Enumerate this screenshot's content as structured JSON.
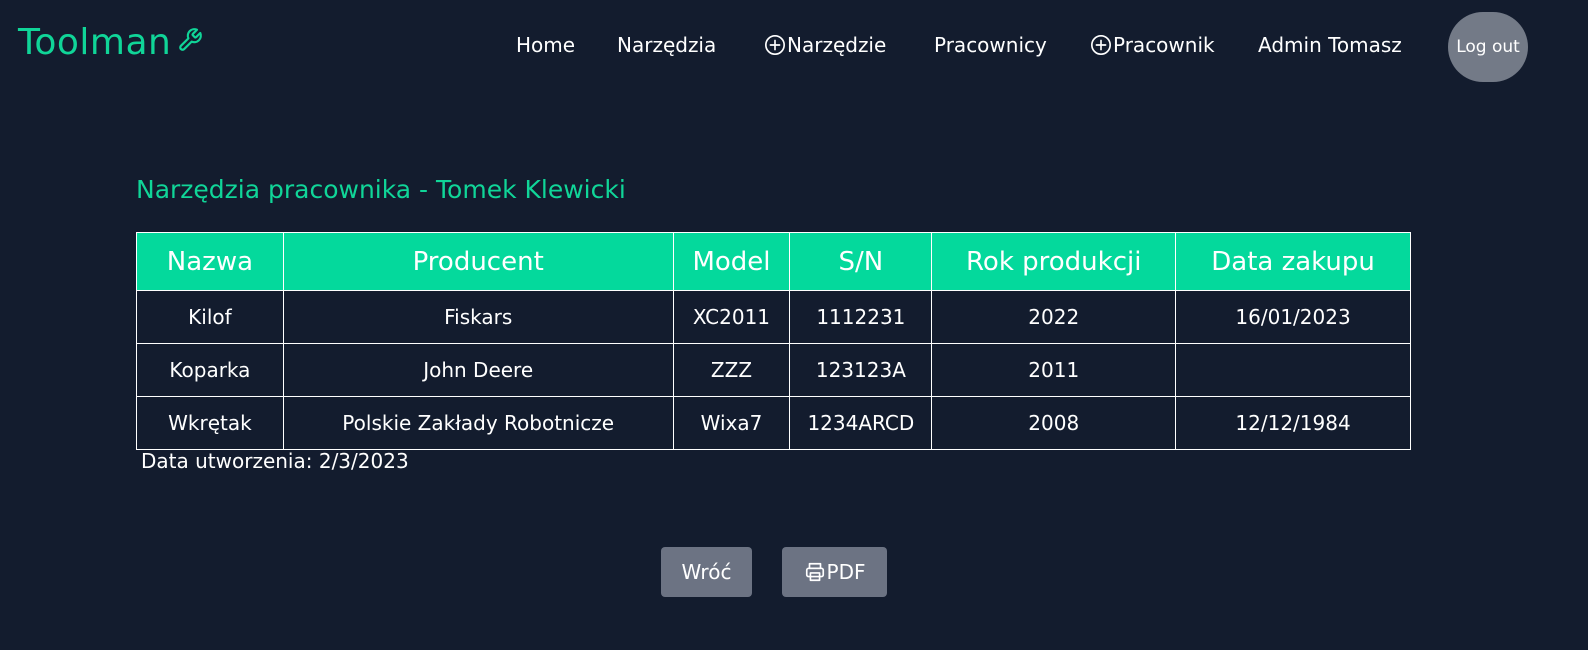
{
  "brand": {
    "name": "Toolman",
    "icon": "wrench-icon",
    "color": "#10d598"
  },
  "nav": {
    "home": "Home",
    "tools": "Narzędzia",
    "add_tool": "Narzędzie",
    "employees": "Pracownicy",
    "add_employee": "Pracownik",
    "user": "Admin Tomasz",
    "logout": "Log out"
  },
  "page": {
    "title": "Narzędzia pracownika - Tomek Klewicki",
    "created_label": "Data utworzenia: ",
    "created_value": "2/3/2023"
  },
  "table": {
    "headers": [
      "Nazwa",
      "Producent",
      "Model",
      "S/N",
      "Rok produkcji",
      "Data zakupu"
    ],
    "rows": [
      [
        "Kilof",
        "Fiskars",
        "XC2011",
        "1112231",
        "2022",
        "16/01/2023"
      ],
      [
        "Koparka",
        "John Deere",
        "ZZZ",
        "123123A",
        "2011",
        ""
      ],
      [
        "Wkrętak",
        "Polskie Zakłady Robotnicze",
        "Wixa7",
        "1234ARCD",
        "2008",
        "12/12/1984"
      ]
    ]
  },
  "buttons": {
    "back": "Wróć",
    "pdf": "PDF",
    "pdf_icon": "printer-icon"
  },
  "colors": {
    "background": "#131c2e",
    "accent": "#10d598",
    "header_bg": "#04d99c",
    "button_bg": "#6c7383",
    "logout_bg": "#737a87"
  }
}
